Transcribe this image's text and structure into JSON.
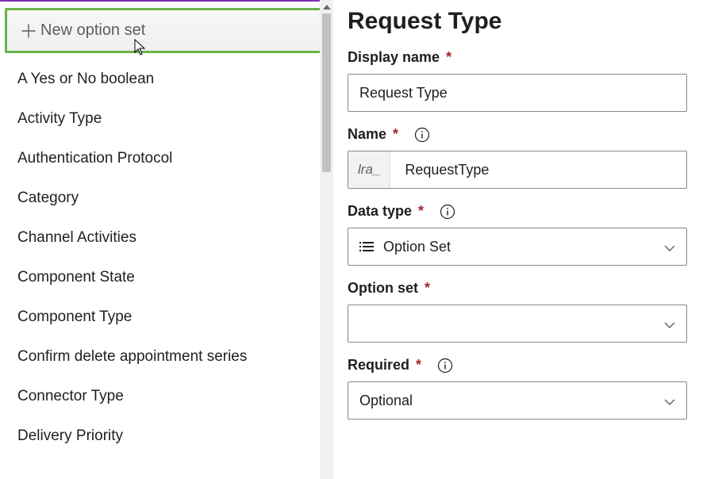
{
  "sidebar": {
    "new_option_label": "New option set",
    "items": [
      "A Yes or No boolean",
      "Activity Type",
      "Authentication Protocol",
      "Category",
      "Channel Activities",
      "Component State",
      "Component Type",
      "Confirm delete appointment series",
      "Connector Type",
      "Delivery Priority"
    ]
  },
  "main": {
    "title": "Request Type",
    "display_name": {
      "label": "Display name",
      "value": "Request Type"
    },
    "name": {
      "label": "Name",
      "prefix": "lra_",
      "value": "RequestType"
    },
    "data_type": {
      "label": "Data type",
      "value": "Option Set"
    },
    "option_set": {
      "label": "Option set",
      "value": ""
    },
    "required": {
      "label": "Required",
      "value": "Optional"
    }
  }
}
